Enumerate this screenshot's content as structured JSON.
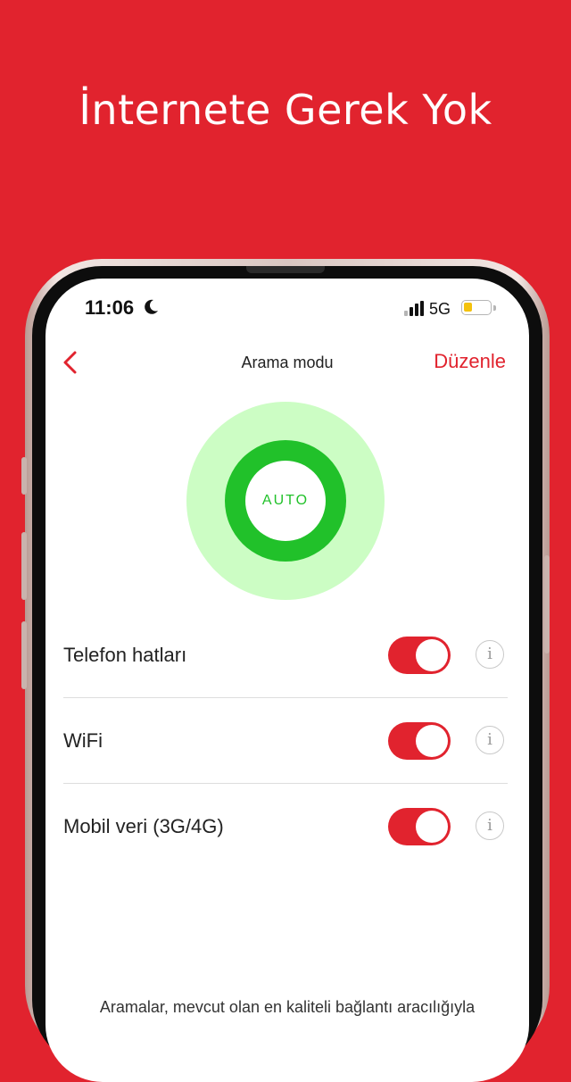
{
  "headline": "İnternete Gerek Yok",
  "status_bar": {
    "time": "11:06",
    "network": "5G",
    "icons": [
      "moon-icon",
      "signal-icon",
      "battery-icon"
    ]
  },
  "nav": {
    "back_icon": "chevron-left-icon",
    "title": "Arama modu",
    "edit_label": "Düzenle"
  },
  "mode": {
    "label": "AUTO"
  },
  "settings": [
    {
      "label": "Telefon hatları",
      "enabled": true,
      "info": "i"
    },
    {
      "label": "WiFi",
      "enabled": true,
      "info": "i"
    },
    {
      "label": "Mobil veri (3G/4G)",
      "enabled": true,
      "info": "i"
    }
  ],
  "footer_text": "Aramalar, mevcut olan en kaliteli bağlantı aracılığıyla",
  "colors": {
    "brand_red": "#e1232e",
    "auto_green": "#21c12a",
    "auto_halo": "#ccfdc4"
  }
}
